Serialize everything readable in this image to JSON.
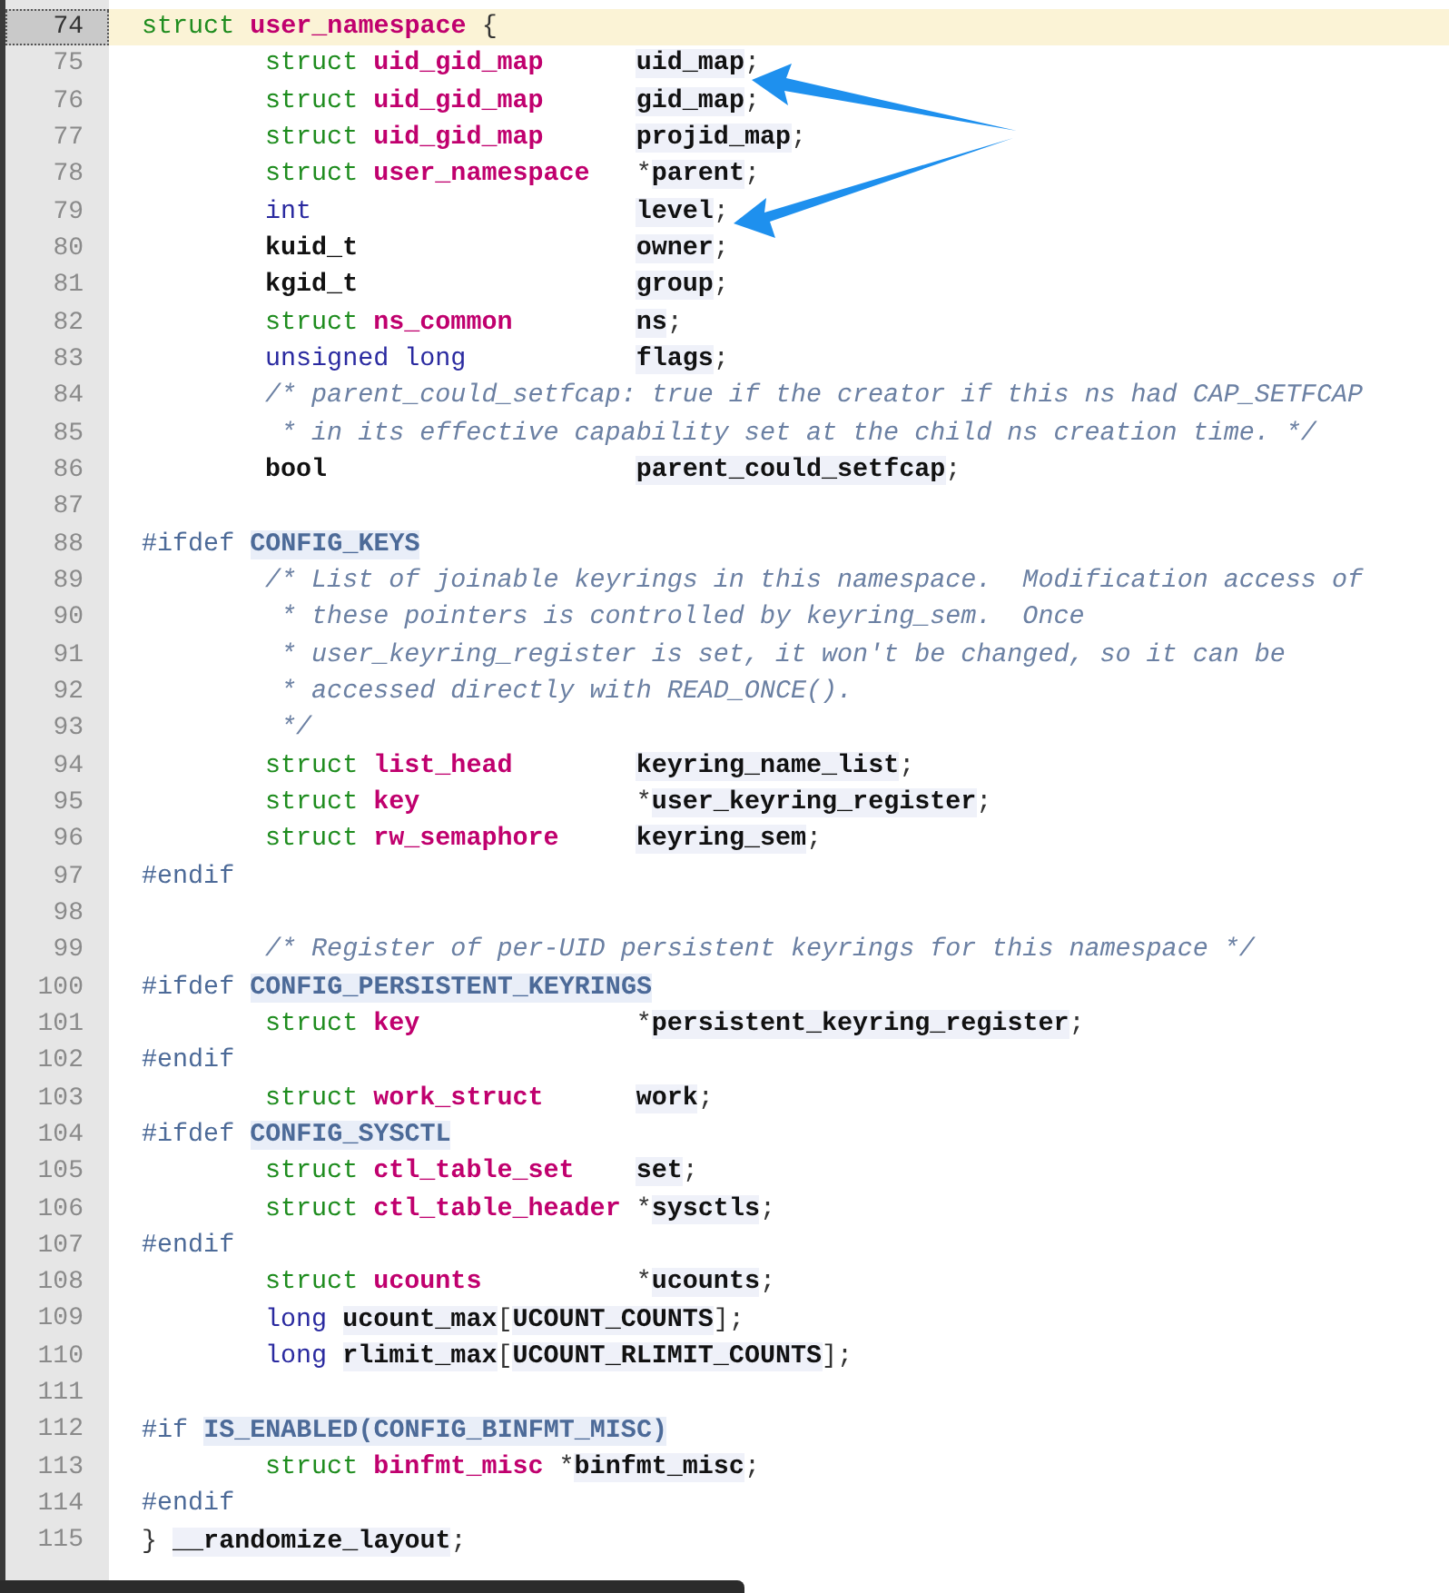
{
  "lines": [
    {
      "number": "74",
      "current": true,
      "indented": false,
      "tokens": [
        {
          "kind": "kw",
          "text": "struct "
        },
        {
          "kind": "type",
          "text": "user_namespace"
        },
        {
          "kind": "plain",
          "text": " {"
        }
      ]
    },
    {
      "number": "75",
      "current": false,
      "indented": true,
      "tokens": [
        {
          "kind": "kw",
          "text": "struct "
        },
        {
          "kind": "type",
          "text": "uid_gid_map      "
        },
        {
          "kind": "ident",
          "text": "uid_map"
        },
        {
          "kind": "plain",
          "text": ";"
        }
      ]
    },
    {
      "number": "76",
      "current": false,
      "indented": true,
      "tokens": [
        {
          "kind": "kw",
          "text": "struct "
        },
        {
          "kind": "type",
          "text": "uid_gid_map      "
        },
        {
          "kind": "ident",
          "text": "gid_map"
        },
        {
          "kind": "plain",
          "text": ";"
        }
      ]
    },
    {
      "number": "77",
      "current": false,
      "indented": true,
      "tokens": [
        {
          "kind": "kw",
          "text": "struct "
        },
        {
          "kind": "type",
          "text": "uid_gid_map      "
        },
        {
          "kind": "ident",
          "text": "projid_map"
        },
        {
          "kind": "plain",
          "text": ";"
        }
      ]
    },
    {
      "number": "78",
      "current": false,
      "indented": true,
      "tokens": [
        {
          "kind": "kw",
          "text": "struct "
        },
        {
          "kind": "type",
          "text": "user_namespace   "
        },
        {
          "kind": "plain",
          "text": "*"
        },
        {
          "kind": "ident",
          "text": "parent"
        },
        {
          "kind": "plain",
          "text": ";"
        }
      ]
    },
    {
      "number": "79",
      "current": false,
      "indented": true,
      "tokens": [
        {
          "kind": "builtin",
          "text": "int                     "
        },
        {
          "kind": "ident",
          "text": "level"
        },
        {
          "kind": "plain",
          "text": ";"
        }
      ]
    },
    {
      "number": "80",
      "current": false,
      "indented": true,
      "tokens": [
        {
          "kind": "name",
          "text": "kuid_t                  "
        },
        {
          "kind": "ident",
          "text": "owner"
        },
        {
          "kind": "plain",
          "text": ";"
        }
      ]
    },
    {
      "number": "81",
      "current": false,
      "indented": true,
      "tokens": [
        {
          "kind": "name",
          "text": "kgid_t                  "
        },
        {
          "kind": "ident",
          "text": "group"
        },
        {
          "kind": "plain",
          "text": ";"
        }
      ]
    },
    {
      "number": "82",
      "current": false,
      "indented": true,
      "tokens": [
        {
          "kind": "kw",
          "text": "struct "
        },
        {
          "kind": "type",
          "text": "ns_common        "
        },
        {
          "kind": "ident",
          "text": "ns"
        },
        {
          "kind": "plain",
          "text": ";"
        }
      ]
    },
    {
      "number": "83",
      "current": false,
      "indented": true,
      "tokens": [
        {
          "kind": "builtin",
          "text": "unsigned long           "
        },
        {
          "kind": "ident",
          "text": "flags"
        },
        {
          "kind": "plain",
          "text": ";"
        }
      ]
    },
    {
      "number": "84",
      "current": false,
      "indented": true,
      "tokens": [
        {
          "kind": "comment",
          "text": "/* parent_could_setfcap: true if the creator if this ns had CAP_SETFCAP"
        }
      ]
    },
    {
      "number": "85",
      "current": false,
      "indented": true,
      "tokens": [
        {
          "kind": "comment",
          "text": " * in its effective capability set at the child ns creation time. */"
        }
      ]
    },
    {
      "number": "86",
      "current": false,
      "indented": true,
      "tokens": [
        {
          "kind": "name",
          "text": "bool                    "
        },
        {
          "kind": "ident",
          "text": "parent_could_setfcap"
        },
        {
          "kind": "plain",
          "text": ";"
        }
      ]
    },
    {
      "number": "87",
      "current": false
    },
    {
      "number": "88",
      "current": false,
      "indented": false,
      "tokens": [
        {
          "kind": "preproc",
          "text": "#ifdef "
        },
        {
          "kind": "macro",
          "text": "CONFIG_KEYS"
        }
      ]
    },
    {
      "number": "89",
      "current": false,
      "indented": true,
      "tokens": [
        {
          "kind": "comment",
          "text": "/* List of joinable keyrings in this namespace.  Modification access of"
        }
      ]
    },
    {
      "number": "90",
      "current": false,
      "indented": true,
      "tokens": [
        {
          "kind": "comment",
          "text": " * these pointers is controlled by keyring_sem.  Once"
        }
      ]
    },
    {
      "number": "91",
      "current": false,
      "indented": true,
      "tokens": [
        {
          "kind": "comment",
          "text": " * user_keyring_register is set, it won't be changed, so it can be"
        }
      ]
    },
    {
      "number": "92",
      "current": false,
      "indented": true,
      "tokens": [
        {
          "kind": "comment",
          "text": " * accessed directly with READ_ONCE()."
        }
      ]
    },
    {
      "number": "93",
      "current": false,
      "indented": true,
      "tokens": [
        {
          "kind": "comment",
          "text": " */"
        }
      ]
    },
    {
      "number": "94",
      "current": false,
      "indented": true,
      "tokens": [
        {
          "kind": "kw",
          "text": "struct "
        },
        {
          "kind": "type",
          "text": "list_head        "
        },
        {
          "kind": "ident",
          "text": "keyring_name_list"
        },
        {
          "kind": "plain",
          "text": ";"
        }
      ]
    },
    {
      "number": "95",
      "current": false,
      "indented": true,
      "tokens": [
        {
          "kind": "kw",
          "text": "struct "
        },
        {
          "kind": "type",
          "text": "key              "
        },
        {
          "kind": "plain",
          "text": "*"
        },
        {
          "kind": "ident",
          "text": "user_keyring_register"
        },
        {
          "kind": "plain",
          "text": ";"
        }
      ]
    },
    {
      "number": "96",
      "current": false,
      "indented": true,
      "tokens": [
        {
          "kind": "kw",
          "text": "struct "
        },
        {
          "kind": "type",
          "text": "rw_semaphore     "
        },
        {
          "kind": "ident",
          "text": "keyring_sem"
        },
        {
          "kind": "plain",
          "text": ";"
        }
      ]
    },
    {
      "number": "97",
      "current": false,
      "indented": false,
      "tokens": [
        {
          "kind": "preproc",
          "text": "#endif"
        }
      ]
    },
    {
      "number": "98",
      "current": false
    },
    {
      "number": "99",
      "current": false,
      "indented": true,
      "tokens": [
        {
          "kind": "comment",
          "text": "/* Register of per-UID persistent keyrings for this namespace */"
        }
      ]
    },
    {
      "number": "100",
      "current": false,
      "indented": false,
      "tokens": [
        {
          "kind": "preproc",
          "text": "#ifdef "
        },
        {
          "kind": "macro",
          "text": "CONFIG_PERSISTENT_KEYRINGS"
        }
      ]
    },
    {
      "number": "101",
      "current": false,
      "indented": true,
      "tokens": [
        {
          "kind": "kw",
          "text": "struct "
        },
        {
          "kind": "type",
          "text": "key              "
        },
        {
          "kind": "plain",
          "text": "*"
        },
        {
          "kind": "ident",
          "text": "persistent_keyring_register"
        },
        {
          "kind": "plain",
          "text": ";"
        }
      ]
    },
    {
      "number": "102",
      "current": false,
      "indented": false,
      "tokens": [
        {
          "kind": "preproc",
          "text": "#endif"
        }
      ]
    },
    {
      "number": "103",
      "current": false,
      "indented": true,
      "tokens": [
        {
          "kind": "kw",
          "text": "struct "
        },
        {
          "kind": "type",
          "text": "work_struct      "
        },
        {
          "kind": "ident",
          "text": "work"
        },
        {
          "kind": "plain",
          "text": ";"
        }
      ]
    },
    {
      "number": "104",
      "current": false,
      "indented": false,
      "tokens": [
        {
          "kind": "preproc",
          "text": "#ifdef "
        },
        {
          "kind": "macro",
          "text": "CONFIG_SYSCTL"
        }
      ]
    },
    {
      "number": "105",
      "current": false,
      "indented": true,
      "tokens": [
        {
          "kind": "kw",
          "text": "struct "
        },
        {
          "kind": "type",
          "text": "ctl_table_set    "
        },
        {
          "kind": "ident",
          "text": "set"
        },
        {
          "kind": "plain",
          "text": ";"
        }
      ]
    },
    {
      "number": "106",
      "current": false,
      "indented": true,
      "tokens": [
        {
          "kind": "kw",
          "text": "struct "
        },
        {
          "kind": "type",
          "text": "ctl_table_header "
        },
        {
          "kind": "plain",
          "text": "*"
        },
        {
          "kind": "ident",
          "text": "sysctls"
        },
        {
          "kind": "plain",
          "text": ";"
        }
      ]
    },
    {
      "number": "107",
      "current": false,
      "indented": false,
      "tokens": [
        {
          "kind": "preproc",
          "text": "#endif"
        }
      ]
    },
    {
      "number": "108",
      "current": false,
      "indented": true,
      "tokens": [
        {
          "kind": "kw",
          "text": "struct "
        },
        {
          "kind": "type",
          "text": "ucounts          "
        },
        {
          "kind": "plain",
          "text": "*"
        },
        {
          "kind": "ident",
          "text": "ucounts"
        },
        {
          "kind": "plain",
          "text": ";"
        }
      ]
    },
    {
      "number": "109",
      "current": false,
      "indented": true,
      "tokens": [
        {
          "kind": "builtin",
          "text": "long "
        },
        {
          "kind": "ident",
          "text": "ucount_max"
        },
        {
          "kind": "plain",
          "text": "["
        },
        {
          "kind": "ident",
          "text": "UCOUNT_COUNTS"
        },
        {
          "kind": "plain",
          "text": "];"
        }
      ]
    },
    {
      "number": "110",
      "current": false,
      "indented": true,
      "tokens": [
        {
          "kind": "builtin",
          "text": "long "
        },
        {
          "kind": "ident",
          "text": "rlimit_max"
        },
        {
          "kind": "plain",
          "text": "["
        },
        {
          "kind": "ident",
          "text": "UCOUNT_RLIMIT_COUNTS"
        },
        {
          "kind": "plain",
          "text": "];"
        }
      ]
    },
    {
      "number": "111",
      "current": false
    },
    {
      "number": "112",
      "current": false,
      "indented": false,
      "tokens": [
        {
          "kind": "preproc",
          "text": "#if "
        },
        {
          "kind": "macro",
          "text": "IS_ENABLED(CONFIG_BINFMT_MISC)"
        }
      ]
    },
    {
      "number": "113",
      "current": false,
      "indented": true,
      "tokens": [
        {
          "kind": "kw",
          "text": "struct "
        },
        {
          "kind": "type",
          "text": "binfmt_misc "
        },
        {
          "kind": "plain",
          "text": "*"
        },
        {
          "kind": "ident",
          "text": "binfmt_misc"
        },
        {
          "kind": "plain",
          "text": ";"
        }
      ]
    },
    {
      "number": "114",
      "current": false,
      "indented": false,
      "tokens": [
        {
          "kind": "preproc",
          "text": "#endif"
        }
      ]
    },
    {
      "number": "115",
      "current": false,
      "indented": false,
      "tokens": [
        {
          "kind": "plain",
          "text": "} "
        },
        {
          "kind": "ident",
          "text": "__randomize_layout"
        },
        {
          "kind": "plain",
          "text": ";"
        }
      ]
    }
  ]
}
